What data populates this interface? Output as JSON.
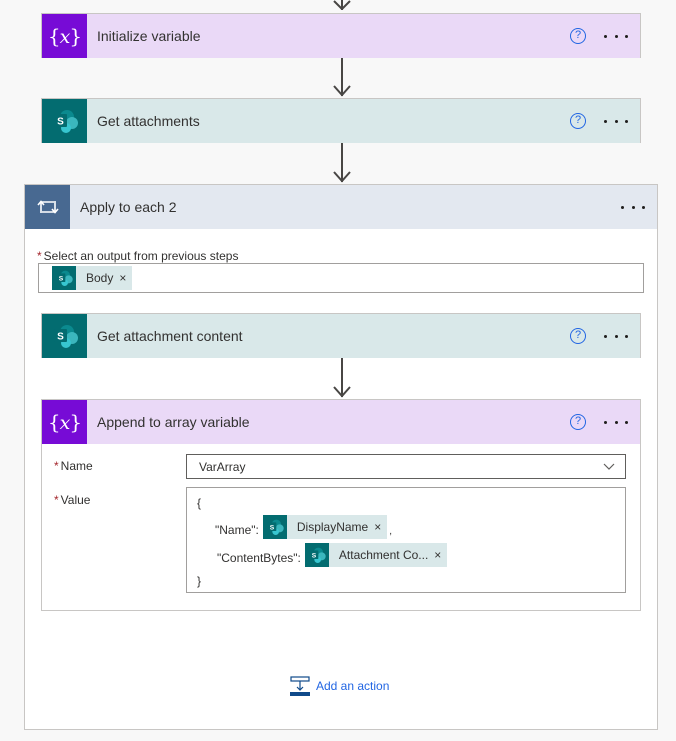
{
  "flow": {
    "steps": [
      {
        "title": "Initialize variable",
        "icon": "variable-icon",
        "help": "?",
        "more": "more-options"
      },
      {
        "title": "Get attachments",
        "icon": "sharepoint-icon",
        "help": "?",
        "more": "more-options"
      }
    ],
    "loop": {
      "title": "Apply to each 2",
      "icon": "loop-icon",
      "select_label": "Select an output from previous steps",
      "required_marker": "*",
      "select_token": {
        "label": "Body",
        "remove": "×"
      },
      "inner_steps": [
        {
          "title": "Get attachment content",
          "icon": "sharepoint-icon",
          "help": "?"
        },
        {
          "title": "Append to array variable",
          "icon": "variable-icon",
          "help": "?",
          "fields": {
            "name_label": "Name",
            "name_value": "VarArray",
            "value_label": "Value",
            "value_lines": {
              "open": "{",
              "name_key": "\"Name\":",
              "name_token": "DisplayName",
              "name_suffix": ",",
              "content_key": "\"ContentBytes\":",
              "content_token": "Attachment Co...",
              "close": "}"
            },
            "remove": "×"
          }
        }
      ],
      "add_action_label": "Add an action"
    }
  },
  "colors": {
    "variable": "#770bd6",
    "variable_bg": "#ead9f7",
    "sharepoint": "#036c70",
    "sharepoint_bg": "#d9e8e9",
    "loop": "#486991",
    "loop_bg": "#e3e8f0",
    "link": "#2266e3",
    "required": "#a4262c"
  }
}
